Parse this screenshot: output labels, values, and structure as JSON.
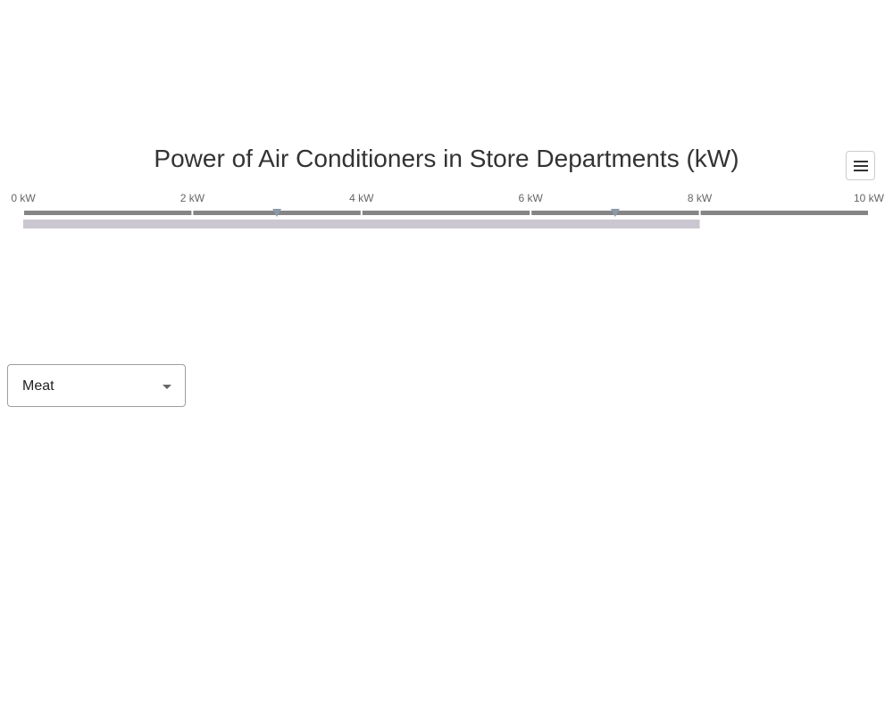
{
  "chart_data": {
    "type": "bar",
    "title": "Power of Air Conditioners in Store Departments (kW)",
    "xlim": [
      0,
      10
    ],
    "ticks": [
      0,
      2,
      4,
      6,
      8,
      10
    ],
    "tick_labels": [
      "0 kW",
      "2 kW",
      "4 kW",
      "6 kW",
      "8 kW",
      "10 kW"
    ],
    "categories": [
      "Meat"
    ],
    "values": [
      8
    ],
    "markers": [
      3,
      7
    ],
    "colors": {
      "bar": "#cbc7d1",
      "band": "#858585",
      "marker": "#8a9aa8"
    }
  },
  "menu": {
    "icon": "hamburger-icon"
  },
  "department_select": {
    "selected": "Meat"
  }
}
